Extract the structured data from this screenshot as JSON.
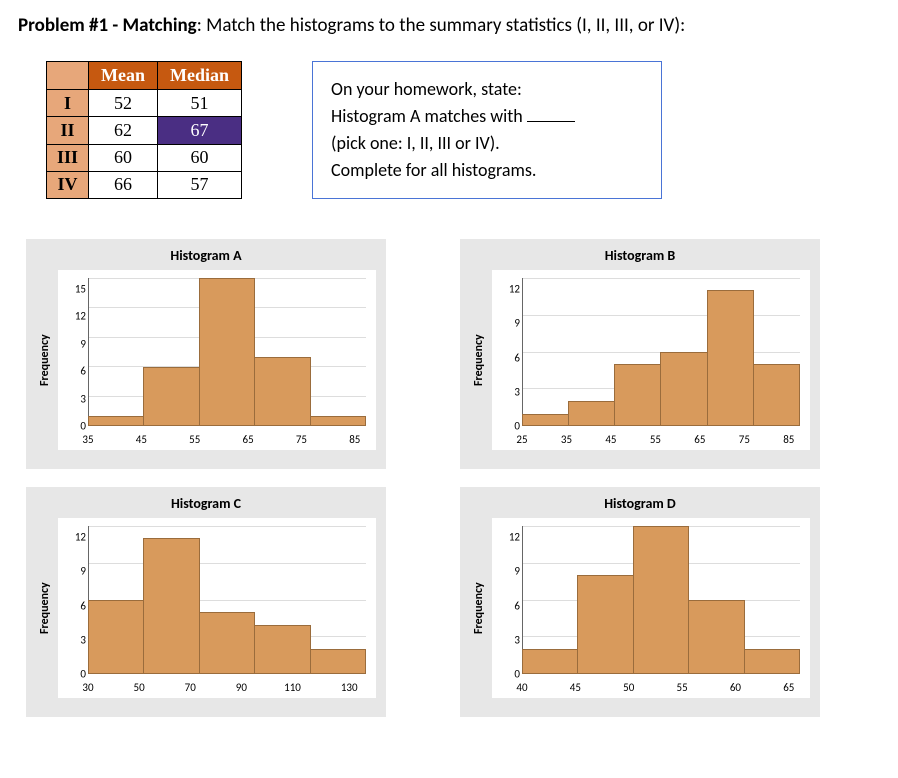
{
  "heading_bold": "Problem #1 - Matching",
  "heading_rest": ":  Match the histograms to the summary statistics (I, II, III, or IV):",
  "table": {
    "headers": [
      "",
      "Mean",
      "Median"
    ],
    "rows": [
      {
        "label": "I",
        "mean": "52",
        "median": "51",
        "highlight": false
      },
      {
        "label": "II",
        "mean": "62",
        "median": "67",
        "highlight": true
      },
      {
        "label": "III",
        "mean": "60",
        "median": "60",
        "highlight": false
      },
      {
        "label": "IV",
        "mean": "66",
        "median": "57",
        "highlight": false
      }
    ]
  },
  "info": {
    "line1": "On your homework, state:",
    "line2a": "Histogram A matches with ",
    "line3": "(pick one: I, II, III or IV).",
    "line4": "Complete for all histograms."
  },
  "ylabel": "Frequency",
  "charts": {
    "A": {
      "title": "Histogram A"
    },
    "B": {
      "title": "Histogram B"
    },
    "C": {
      "title": "Histogram C"
    },
    "D": {
      "title": "Histogram D"
    }
  },
  "chart_data": [
    {
      "type": "bar",
      "name": "A",
      "title": "Histogram A",
      "xlabel": "",
      "ylabel": "Frequency",
      "ylim": [
        0,
        15
      ],
      "yticks": [
        0,
        3,
        6,
        9,
        12,
        15
      ],
      "x_edges": [
        35,
        45,
        55,
        65,
        75,
        85
      ],
      "categories": [
        "35-45",
        "45-55",
        "55-65",
        "65-75",
        "75-85"
      ],
      "values": [
        1,
        6,
        15,
        7,
        1
      ]
    },
    {
      "type": "bar",
      "name": "B",
      "title": "Histogram B",
      "xlabel": "",
      "ylabel": "Frequency",
      "ylim": [
        0,
        12
      ],
      "yticks": [
        0,
        3,
        6,
        9,
        12
      ],
      "x_edges": [
        25,
        35,
        45,
        55,
        65,
        75,
        85
      ],
      "categories": [
        "25-35",
        "35-45",
        "45-55",
        "55-65",
        "65-75",
        "75-85"
      ],
      "values": [
        1,
        2,
        5,
        6,
        11,
        5
      ]
    },
    {
      "type": "bar",
      "name": "C",
      "title": "Histogram C",
      "xlabel": "",
      "ylabel": "Frequency",
      "ylim": [
        0,
        12
      ],
      "yticks": [
        0,
        3,
        6,
        9,
        12
      ],
      "x_edges": [
        30,
        50,
        70,
        90,
        110,
        130
      ],
      "categories": [
        "30-50",
        "50-70",
        "70-90",
        "90-110",
        "110-130"
      ],
      "values": [
        6,
        11,
        5,
        4,
        2
      ]
    },
    {
      "type": "bar",
      "name": "D",
      "title": "Histogram D",
      "xlabel": "",
      "ylabel": "Frequency",
      "ylim": [
        0,
        12
      ],
      "yticks": [
        0,
        3,
        6,
        9,
        12
      ],
      "x_edges": [
        40,
        45,
        50,
        55,
        60,
        65
      ],
      "categories": [
        "40-45",
        "45-50",
        "50-55",
        "55-60",
        "60-65"
      ],
      "values": [
        2,
        8,
        12,
        6,
        2
      ]
    }
  ]
}
